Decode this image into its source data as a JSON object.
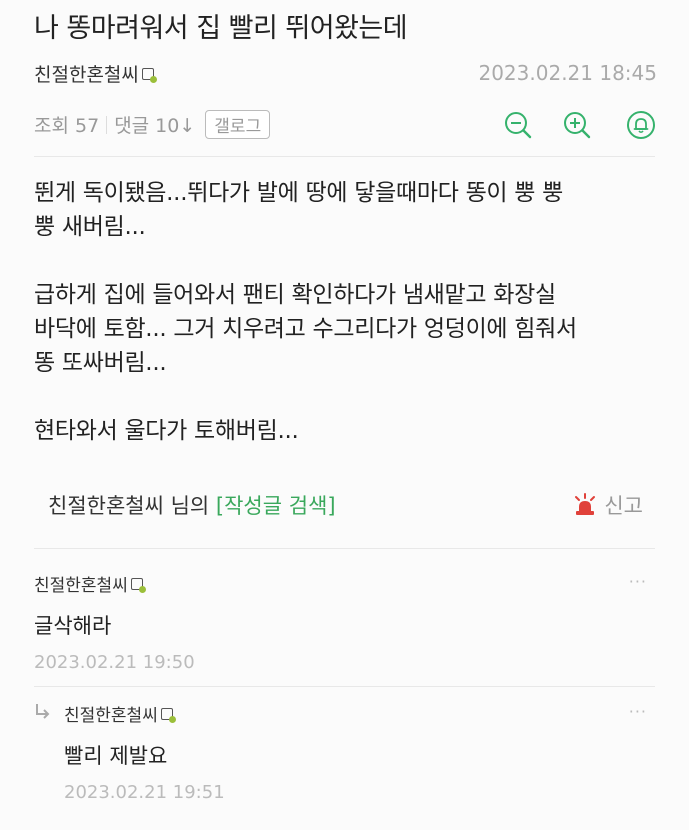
{
  "post": {
    "title": "나 똥마려워서 집 빨리 뛰어왔는데",
    "author": "친절한혼철씨",
    "date": "2023.02.21 18:45",
    "views": "조회 57",
    "comments_link": "댓글 10↓",
    "gallery_button": "갤로그",
    "body": [
      "뛴게 독이됐음...뛰다가 발에 땅에 닿을때마다 똥이 뿡 뿡\n뿡 새버림...",
      "급하게 집에 들어와서 팬티 확인하다가 냄새맡고 화장실\n바닥에 토함... 그거 치우려고 수그리다가 엉덩이에 힘줘서\n똥 또싸버림...",
      "현타와서 울다가 토해버림..."
    ],
    "author_search_prefix": "친절한혼철씨 님의 ",
    "author_search_link": "[작성글 검색]",
    "report_label": "신고"
  },
  "comments": [
    {
      "author": "친절한혼철씨",
      "text": "글삭해라",
      "date": "2023.02.21 19:50",
      "more": "···"
    },
    {
      "author": "친절한혼철씨",
      "text": "빨리 제발요",
      "date": "2023.02.21 19:51",
      "more": "···",
      "reply_icon": "reply-arrow-icon"
    }
  ],
  "icons": {
    "zoom_out": "zoom-out-icon",
    "zoom_in": "zoom-in-icon",
    "notification": "bell-icon",
    "report": "siren-icon"
  },
  "colors": {
    "accent": "#3aa85c",
    "icon_green": "#35b26c",
    "report_red": "#e0413a",
    "muted": "#aaaaaa"
  }
}
